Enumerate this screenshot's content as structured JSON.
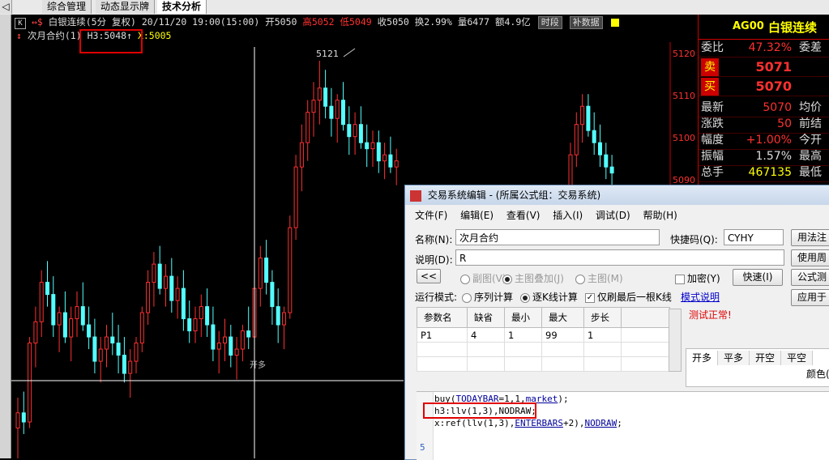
{
  "tabs": [
    "综合管理",
    "动态显示牌",
    "技术分析"
  ],
  "info": {
    "symbol": "白银连续",
    "period": "(5分 复权)",
    "datetime": "20/11/20 19:00(15:00)",
    "open": "开5050",
    "high": "高5052",
    "low": "低5049",
    "close": "收5050",
    "turnover_rate": "换2.99%",
    "volume": "量6477",
    "amount": "额4.9亿",
    "btn1": "时段",
    "btn2": "补数据"
  },
  "indicator": {
    "name": "次月合约(1)",
    "h3": "H3:5048",
    "x": "X:5005",
    "peak_label": "5121",
    "kaiduo": "开多"
  },
  "price_axis": [
    "5120",
    "5110",
    "5100",
    "5090"
  ],
  "chart_data": {
    "type": "candlestick",
    "title": "白银连续 (5分 复权)",
    "ylim": [
      4990,
      5125
    ],
    "candles": [
      [
        5000,
        5010,
        4990,
        5005
      ],
      [
        5005,
        5012,
        4998,
        5002
      ],
      [
        5002,
        5030,
        5000,
        5028
      ],
      [
        5028,
        5040,
        5020,
        5035
      ],
      [
        5035,
        5052,
        5030,
        5048
      ],
      [
        5048,
        5055,
        5040,
        5044
      ],
      [
        5044,
        5050,
        5030,
        5034
      ],
      [
        5034,
        5040,
        5025,
        5038
      ],
      [
        5038,
        5045,
        5028,
        5030
      ],
      [
        5030,
        5040,
        5022,
        5036
      ],
      [
        5036,
        5045,
        5030,
        5040
      ],
      [
        5040,
        5048,
        5032,
        5034
      ],
      [
        5034,
        5040,
        5026,
        5030
      ],
      [
        5030,
        5036,
        5018,
        5022
      ],
      [
        5022,
        5030,
        5015,
        5026
      ],
      [
        5026,
        5034,
        5020,
        5030
      ],
      [
        5030,
        5038,
        5024,
        5028
      ],
      [
        5028,
        5034,
        5018,
        5024
      ],
      [
        5024,
        5030,
        5015,
        5018
      ],
      [
        5018,
        5026,
        5010,
        5022
      ],
      [
        5022,
        5030,
        5018,
        5028
      ],
      [
        5028,
        5040,
        5025,
        5038
      ],
      [
        5038,
        5052,
        5034,
        5048
      ],
      [
        5048,
        5058,
        5040,
        5054
      ],
      [
        5054,
        5060,
        5044,
        5046
      ],
      [
        5046,
        5054,
        5040,
        5050
      ],
      [
        5050,
        5056,
        5038,
        5042
      ],
      [
        5042,
        5050,
        5036,
        5046
      ],
      [
        5046,
        5052,
        5032,
        5036
      ],
      [
        5036,
        5042,
        5028,
        5032
      ],
      [
        5032,
        5040,
        5028,
        5036
      ],
      [
        5036,
        5044,
        5030,
        5040
      ],
      [
        5040,
        5046,
        5030,
        5034
      ],
      [
        5034,
        5040,
        5022,
        5026
      ],
      [
        5026,
        5032,
        5018,
        5028
      ],
      [
        5028,
        5036,
        5022,
        5030
      ],
      [
        5030,
        5034,
        5020,
        5024
      ],
      [
        5024,
        5030,
        5016,
        5026
      ],
      [
        5026,
        5034,
        5022,
        5032
      ],
      [
        5032,
        5040,
        5026,
        5030
      ],
      [
        5030,
        5048,
        5028,
        5046
      ],
      [
        5046,
        5060,
        5040,
        5056
      ],
      [
        5056,
        5062,
        5044,
        5048
      ],
      [
        5048,
        5052,
        5034,
        5040
      ],
      [
        5040,
        5046,
        5028,
        5034
      ],
      [
        5034,
        5040,
        5026,
        5038
      ],
      [
        5038,
        5070,
        5036,
        5066
      ],
      [
        5066,
        5090,
        5062,
        5086
      ],
      [
        5086,
        5100,
        5078,
        5094
      ],
      [
        5094,
        5108,
        5088,
        5104
      ],
      [
        5104,
        5114,
        5096,
        5108
      ],
      [
        5108,
        5121,
        5100,
        5112
      ],
      [
        5112,
        5118,
        5102,
        5106
      ],
      [
        5106,
        5112,
        5096,
        5102
      ],
      [
        5102,
        5110,
        5094,
        5108
      ],
      [
        5108,
        5114,
        5098,
        5100
      ],
      [
        5100,
        5106,
        5090,
        5096
      ],
      [
        5096,
        5104,
        5090,
        5100
      ],
      [
        5100,
        5106,
        5092,
        5094
      ],
      [
        5094,
        5100,
        5086,
        5092
      ],
      [
        5092,
        5098,
        5086,
        5094
      ],
      [
        5094,
        5098,
        5084,
        5088
      ],
      [
        5088,
        5094,
        5082,
        5090
      ],
      [
        5090,
        5096,
        5084,
        5086
      ],
      [
        5086,
        5092,
        5080,
        5088
      ]
    ],
    "tail_candles": [
      [
        5080,
        5094,
        5076,
        5090
      ],
      [
        5090,
        5104,
        5086,
        5100
      ],
      [
        5100,
        5110,
        5094,
        5106
      ],
      [
        5106,
        5110,
        5096,
        5098
      ],
      [
        5098,
        5104,
        5090,
        5094
      ],
      [
        5094,
        5100,
        5086,
        5090
      ],
      [
        5090,
        5094,
        5082,
        5086
      ],
      [
        5086,
        5090,
        5078,
        5084
      ]
    ]
  },
  "quote": {
    "code": "AG00",
    "name": "白银连续",
    "rows": [
      {
        "label": "委比",
        "value": "47.32%",
        "label2": "委差",
        "color": "#ff3030"
      },
      {
        "label": "卖",
        "value": "5071",
        "label2": "",
        "color": "#ff3030"
      },
      {
        "label": "买",
        "value": "5070",
        "label2": "",
        "color": "#ff3030"
      },
      {
        "label": "最新",
        "value": "5070",
        "label2": "均价",
        "color": "#ff3030"
      },
      {
        "label": "涨跌",
        "value": "50",
        "label2": "前结",
        "color": "#ff3030"
      },
      {
        "label": "幅度",
        "value": "+1.00%",
        "label2": "今开",
        "color": "#ff3030"
      },
      {
        "label": "振幅",
        "value": "1.57%",
        "label2": "最高",
        "color": "#dddddd"
      },
      {
        "label": "总手",
        "value": "467135",
        "label2": "最低",
        "color": "#ffff00"
      }
    ]
  },
  "dialog": {
    "title": "交易系统编辑 - (所属公式组：交易系统)",
    "menu": [
      "文件(F)",
      "编辑(E)",
      "查看(V)",
      "插入(I)",
      "调试(D)",
      "帮助(H)"
    ],
    "name_label": "名称(N):",
    "name_value": "次月合约",
    "shortcut_label": "快捷码(Q):",
    "shortcut_value": "CYHY",
    "desc_label": "说明(D):",
    "desc_value": "R",
    "btn_usage": "用法注",
    "btn_use": "使用周",
    "btn_formula": "公式测",
    "btn_apply": "应用于",
    "btn_back": "<<",
    "radio_sub": "副图(V)",
    "radio_main_overlay": "主图叠加(J)",
    "radio_main": "主图(M)",
    "chk_encrypt": "加密(Y)",
    "btn_quick": "快速(I)",
    "mode_label": "运行模式:",
    "mode_seq": "序列计算",
    "mode_kline": "逐K线计算",
    "mode_last": "仅刷最后一根K线",
    "mode_help": "模式说明",
    "test_ok": "测试正常!",
    "params_headers": [
      "参数名",
      "缺省",
      "最小",
      "最大",
      "步长"
    ],
    "params_rows": [
      [
        "P1",
        "4",
        "1",
        "99",
        "1"
      ]
    ],
    "tabs2": [
      "开多",
      "平多",
      "开空",
      "平空"
    ],
    "color_label": "颜色(",
    "code": [
      "buy(TODAYBAR=1,1,market);",
      "h3:llv(1,3),NODRAW;",
      "x:ref(llv(1,3),ENTERBARS+2),NODRAW;"
    ],
    "line_number": "5"
  }
}
